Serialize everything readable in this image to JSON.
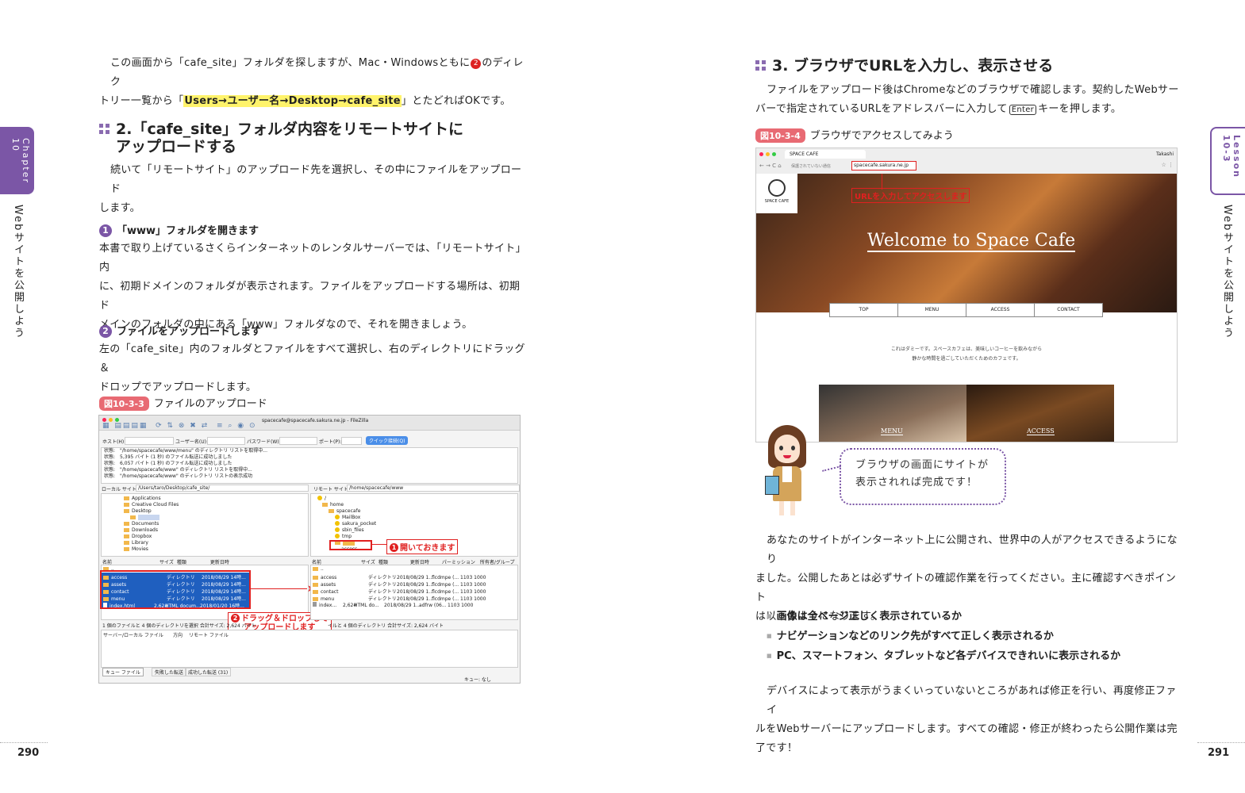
{
  "left_page": {
    "intro_line1_a": "この画面から「cafe_site」フォルダを探しますが、Mac・Windowsともに",
    "intro_marker": "2",
    "intro_line1_b": "のディレク",
    "intro_line2_a": "トリー一覧から「",
    "intro_highlight": "Users→ユーザー名→Desktop→cafe_site",
    "intro_line2_b": "」とたどればOKです。",
    "section2_title_line1": "2.「cafe_site」フォルダ内容をリモートサイトに",
    "section2_title_line2": "アップロードする",
    "section2_para_line1": "続いて「リモートサイト」のアップロード先を選択し、その中にファイルをアップロード",
    "section2_para_line2": "します。",
    "step1_num": "1",
    "step1_title": "「www」フォルダを開きます",
    "step1_line1": "本書で取り上げているさくらインターネットのレンタルサーバーでは、「リモートサイト」内",
    "step1_line2": "に、初期ドメインのフォルダが表示されます。ファイルをアップロードする場所は、初期ド",
    "step1_line3": "メインのフォルダの中にある「www」フォルダなので、それを開きましょう。",
    "step2_num": "2",
    "step2_title": "ファイルをアップロードします",
    "step2_line1": "左の「cafe_site」内のフォルダとファイルをすべて選択し、右のディレクトリにドラッグ＆",
    "step2_line2": "ドロップでアップロードします。",
    "figure_label": "図10-3-3",
    "figure_caption": "ファイルのアップロード",
    "page_number": "290",
    "side_chapter": "Chapter 10",
    "side_title": "Webサイトを公開しよう"
  },
  "filezilla": {
    "title": "spacecafe@spacecafe.sakura.ne.jp - FileZilla",
    "host_label": "ホスト(H):",
    "user_label": "ユーザー名(U):",
    "pass_label": "パスワード(W):",
    "port_label": "ポート(P):",
    "connect_button": "クイック接続(Q)",
    "log": [
      "状態:　\"/home/spacecafe/www/menu\" のディレクトリ リストを取得中...",
      "状態:　5,395 バイト (1 秒) のファイル転送に成功しました",
      "状態:　6,057 バイト (1 秒) のファイル転送に成功しました",
      "状態:　\"/home/spacecafe/www\" のディレクトリ リストを取得中...",
      "状態:　\"/home/spacecafe/www\" のディレクトリ リストの表示成功"
    ],
    "local_label": "ローカル サイト:",
    "local_path": "/Users/taro/Desktop/cafe_site/",
    "remote_label": "リモート サイト:",
    "remote_path": "/home/spacecafe/www",
    "local_tree": [
      "Applications",
      "Creative Cloud Files",
      "Desktop",
      "cafe_site",
      "Documents",
      "Downloads",
      "Dropbox",
      "Library",
      "Movies"
    ],
    "remote_tree": [
      "/",
      "home",
      "spacecafe",
      "MailBox",
      "sakura_pocket",
      "sbin_files",
      "tmp",
      "www",
      "access"
    ],
    "list_headers_local": [
      "名前",
      "サイズ",
      "種類",
      "更新日時"
    ],
    "list_headers_remote": [
      "名前",
      "サイズ",
      "種類",
      "更新日時",
      "パーミッション",
      "所有者/グループ"
    ],
    "local_files": [
      {
        "name": "..",
        "size": "",
        "type": "",
        "date": ""
      },
      {
        "name": "access",
        "size": "",
        "type": "ディレクトリ",
        "date": "2018/08/29 14時..."
      },
      {
        "name": "assets",
        "size": "",
        "type": "ディレクトリ",
        "date": "2018/08/29 14時..."
      },
      {
        "name": "contact",
        "size": "",
        "type": "ディレクトリ",
        "date": "2018/08/29 14時..."
      },
      {
        "name": "menu",
        "size": "",
        "type": "ディレクトリ",
        "date": "2018/08/29 14時..."
      },
      {
        "name": "index.html",
        "size": "2,624",
        "type": "HTML docum...",
        "date": "2018/01/20 16時..."
      }
    ],
    "remote_files": [
      {
        "name": "..",
        "size": "",
        "type": "",
        "date": "",
        "perm": "",
        "owner": ""
      },
      {
        "name": "access",
        "size": "",
        "type": "ディレクトリ",
        "date": "2018/08/29 1...",
        "perm": "flcdmpe (...",
        "owner": "1103 1000"
      },
      {
        "name": "assets",
        "size": "",
        "type": "ディレクトリ",
        "date": "2018/08/29 1...",
        "perm": "flcdmpe (...",
        "owner": "1103 1000"
      },
      {
        "name": "contact",
        "size": "",
        "type": "ディレクトリ",
        "date": "2018/08/29 1...",
        "perm": "flcdmpe (...",
        "owner": "1103 1000"
      },
      {
        "name": "menu",
        "size": "",
        "type": "ディレクトリ",
        "date": "2018/08/29 1...",
        "perm": "flcdmpe (...",
        "owner": "1103 1000"
      },
      {
        "name": "index...",
        "size": "2,624",
        "type": "HTML do...",
        "date": "2018/08/29 1...",
        "perm": "adfrw (06...",
        "owner": "1103 1000"
      }
    ],
    "local_status": "1 個のファイルと 4 個のディレクトリを選択 合計サイズ: 2,624 バイト",
    "remote_status": "イルと 4 個のディレクトリ 合計サイズ: 2,624 バイト",
    "queue_headers": [
      "サーバー/ローカル ファイル",
      "方向",
      "リモート ファイル"
    ],
    "queue_tabs": [
      "キュー ファイル",
      "失敗した転送",
      "成功した転送 (31)"
    ],
    "queue_status": "キュー: なし",
    "callout1_num": "1",
    "callout1": "開いておきます",
    "callout2_num": "2",
    "callout2_line1": "ドラッグ＆ドロップして",
    "callout2_line2": "アップロードします"
  },
  "right_page": {
    "section3_title": "3. ブラウザでURLを入力し、表示させる",
    "section3_line1": "ファイルをアップロード後はChromeなどのブラウザで確認します。契約したWebサー",
    "section3_line2_a": "バーで指定されているURLをアドレスバーに入力して",
    "enter_key": "Enter",
    "section3_line2_b": "キーを押します。",
    "figure_label": "図10-3-4",
    "figure_caption": "ブラウザでアクセスしてみよう",
    "browser": {
      "tab_title": "SPACE CAFE",
      "user": "Takashi",
      "insecure": "保護されていない通信",
      "url": "spacecafe.sakura.ne.jp",
      "url_callout": "URLを入力してアクセスします",
      "logo_text": "SPACE CAFE",
      "hero_title": "Welcome to Space Cafe",
      "nav": [
        "TOP",
        "MENU",
        "ACCESS",
        "CONTACT"
      ],
      "desc_line1": "これはダミーです。スペースカフェは、美味しいコーヒーを飲みながら",
      "desc_line2": "静かな時間を過ごしていただくためのカフェです。",
      "tile1": "MENU",
      "tile2": "ACCESS"
    },
    "bubble_line1": "ブラウザの画面にサイトが",
    "bubble_line2": "表示されれば完成です！",
    "para_line1": "あなたのサイトがインターネット上に公開され、世界中の人がアクセスできるようになり",
    "para_line2": "ました。公開したあとは必ずサイトの確認作業を行ってください。主に確認すべきポイント",
    "para_line3": "は以下のようになります。",
    "checklist": [
      "画像は全ページ正しく表示されているか",
      "ナビゲーションなどのリンク先がすべて正しく表示されるか",
      "PC、スマートフォン、タブレットなど各デバイスできれいに表示されるか"
    ],
    "final_line1": "デバイスによって表示がうまくいっていないところがあれば修正を行い、再度修正ファイ",
    "final_line2": "ルをWebサーバーにアップロードします。すべての確認・修正が終わったら公開作業は完",
    "final_line3": "了です！",
    "page_number": "291",
    "side_lesson": "Lesson 10-3",
    "side_title": "Webサイトを公開しよう"
  },
  "colors": {
    "accent_purple": "#7b56a6",
    "label_red": "#e86a73",
    "highlight_yellow": "#fff36b",
    "callout_red": "#e02020"
  }
}
